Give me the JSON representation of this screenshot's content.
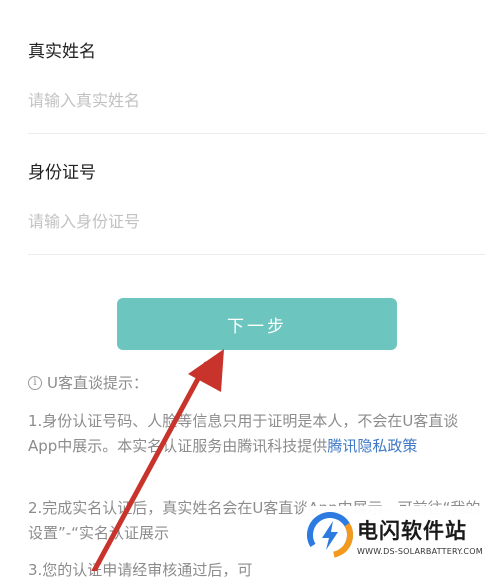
{
  "form": {
    "name_label": "真实姓名",
    "name_placeholder": "请输入真实姓名",
    "name_value": "",
    "id_label": "身份证号",
    "id_placeholder": "请输入身份证号",
    "id_value": ""
  },
  "next_button": {
    "label": "下一步"
  },
  "tips": {
    "title": "U客直谈提示：",
    "tip1_text": "1.身份认证号码、人脸等信息只用于证明是本人，不会在U客直谈App中展示。本实名认证服务由腾讯科技提供",
    "tip1_link": "腾讯隐私政策",
    "tip2_text": "2.完成实名认证后，真实姓名会在U客直谈App中展示，可前往“我的设置”-“实名认证展示",
    "tip3_text": "3.您的认证申请经审核通过后，可"
  },
  "annotation": {
    "arrow_color": "#c8342c"
  },
  "watermark": {
    "title": "电闪软件站",
    "subtitle": "WWW.DS-SOLARBATTERY.COM",
    "colors": {
      "blue": "#2d7be0",
      "orange": "#f39a1e"
    }
  },
  "icons": {
    "info": "info-circle-icon"
  }
}
